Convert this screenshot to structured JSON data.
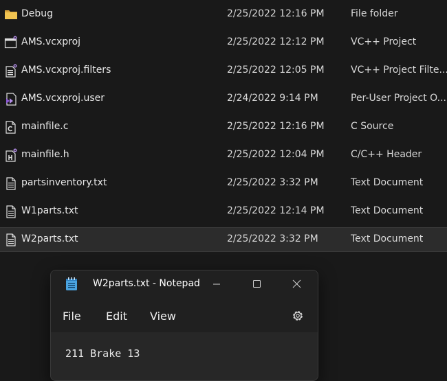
{
  "explorer": {
    "files": [
      {
        "icon": "folder-icon",
        "name": "Debug",
        "date": "2/25/2022 12:16 PM",
        "type": "File folder"
      },
      {
        "icon": "vcxproj-icon",
        "name": "AMS.vcxproj",
        "date": "2/25/2022 12:12 PM",
        "type": "VC++ Project"
      },
      {
        "icon": "filters-icon",
        "name": "AMS.vcxproj.filters",
        "date": "2/25/2022 12:05 PM",
        "type": "VC++ Project Filte..."
      },
      {
        "icon": "user-file-icon",
        "name": "AMS.vcxproj.user",
        "date": "2/24/2022 9:14 PM",
        "type": "Per-User Project O..."
      },
      {
        "icon": "c-source-icon",
        "name": "mainfile.c",
        "date": "2/25/2022 12:16 PM",
        "type": "C Source"
      },
      {
        "icon": "c-header-icon",
        "name": "mainfile.h",
        "date": "2/25/2022 12:04 PM",
        "type": "C/C++ Header"
      },
      {
        "icon": "text-file-icon",
        "name": "partsinventory.txt",
        "date": "2/25/2022 3:32 PM",
        "type": "Text Document"
      },
      {
        "icon": "text-file-icon",
        "name": "W1parts.txt",
        "date": "2/25/2022 12:14 PM",
        "type": "Text Document"
      },
      {
        "icon": "text-file-icon",
        "name": "W2parts.txt",
        "date": "2/25/2022 3:32 PM",
        "type": "Text Document",
        "selected": true
      }
    ]
  },
  "notepad": {
    "title": "W2parts.txt - Notepad",
    "menu": {
      "file": "File",
      "edit": "Edit",
      "view": "View"
    },
    "content": "211 Brake 13"
  },
  "colors": {
    "background": "#191919",
    "selected_row": "#2c2c2c",
    "folder": "#e8b84a",
    "notepad_icon": "#4aa3df",
    "vs_purple": "#8e5ad6"
  }
}
